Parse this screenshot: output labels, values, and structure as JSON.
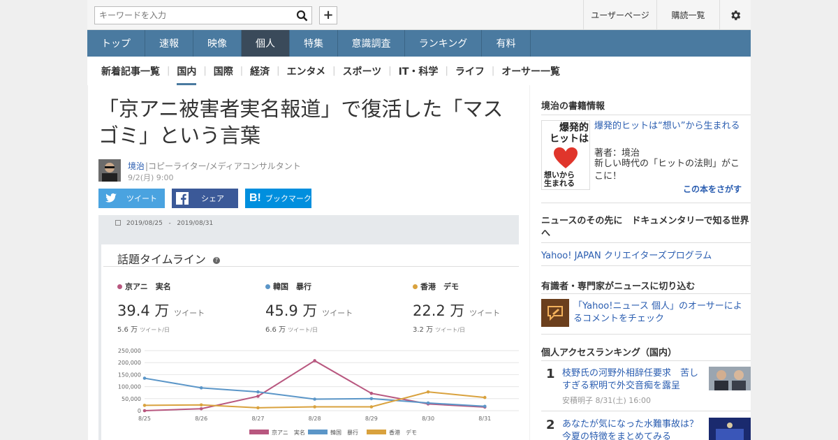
{
  "header": {
    "search_placeholder": "キーワードを入力",
    "user_page": "ユーザーページ",
    "subscriptions": "購読一覧"
  },
  "nav": [
    "トップ",
    "速報",
    "映像",
    "個人",
    "特集",
    "意識調査",
    "ランキング",
    "有料"
  ],
  "subnav": [
    "新着記事一覧",
    "国内",
    "国際",
    "経済",
    "エンタメ",
    "スポーツ",
    "IT・科学",
    "ライフ",
    "オーサー一覧"
  ],
  "article": {
    "title": "「京アニ被害者実名報道」で復活した「マスゴミ」という言葉",
    "author": "境治",
    "role": "|コピーライター/メディアコンサルタント",
    "date": "9/2(月) 9:00"
  },
  "share": {
    "tweet": "ツイート",
    "share": "シェア",
    "bookmark": "ブックマーク"
  },
  "timeline": {
    "range_start": "2019/08/25",
    "range_sep": "-",
    "range_end": "2019/08/31",
    "title": "話題タイムライン",
    "stats": [
      {
        "name": "京アニ　実名",
        "total": "39.4 万",
        "total_unit": "ツイート",
        "daily": "5.6 万",
        "daily_unit": "ツイート/日",
        "color": "#b8577f"
      },
      {
        "name": "韓国　暴行",
        "total": "45.9 万",
        "total_unit": "ツイート",
        "daily": "6.6 万",
        "daily_unit": "ツイート/日",
        "color": "#5b96c8"
      },
      {
        "name": "香港　デモ",
        "total": "22.2 万",
        "total_unit": "ツイート",
        "daily": "3.2 万",
        "daily_unit": "ツイート/日",
        "color": "#d9a23e"
      }
    ]
  },
  "chart_data": {
    "type": "line",
    "x": [
      "8/25",
      "8/26",
      "8/27",
      "8/28",
      "8/29",
      "8/30",
      "8/31"
    ],
    "yticks": [
      "250,000",
      "200,000",
      "150,000",
      "100,000",
      "50,000",
      "0"
    ],
    "ylim": [
      0,
      250000
    ],
    "series": [
      {
        "name": "京アニ　実名",
        "color": "#b8577f",
        "values": [
          0,
          8000,
          60000,
          208000,
          72000,
          28000,
          15000
        ]
      },
      {
        "name": "韓国　暴行",
        "color": "#5b96c8",
        "values": [
          135000,
          95000,
          78000,
          48000,
          50000,
          32000,
          18000
        ]
      },
      {
        "name": "香港　デモ",
        "color": "#d9a23e",
        "values": [
          22000,
          24000,
          12000,
          16000,
          16000,
          78000,
          55000
        ]
      }
    ]
  },
  "sidebar": {
    "book_head": "境治の書籍情報",
    "book_title": "爆発的ヒットは“想い”から生まれる",
    "book_author": "著者：境治",
    "book_desc": "新しい時代の「ヒットの法則」がここに！",
    "book_link": "この本をさがす",
    "book_cover_text1": "爆発的",
    "book_cover_text2": "ヒットは",
    "book_cover_text3": "想いから",
    "book_cover_text4": "生まれる",
    "doc_head": "ニュースのその先に　ドキュメンタリーで知る世界へ",
    "doc_link": "Yahoo! JAPAN クリエイターズプログラム",
    "expert_head": "有識者・専門家がニュースに切り込む",
    "expert_link": "「Yahoo!ニュース 個人」のオーサーによるコメントをチェック",
    "rank_head": "個人アクセスランキング（国内）",
    "ranking": [
      {
        "num": "1",
        "title": "枝野氏の河野外相辞任要求　苦しすぎる釈明で外交音痴を露呈",
        "meta": "安積明子  8/31(土) 16:00"
      },
      {
        "num": "2",
        "title": "あなたが気になった水難事故は？今夏の特徴をまとめてみる",
        "meta": ""
      }
    ]
  }
}
